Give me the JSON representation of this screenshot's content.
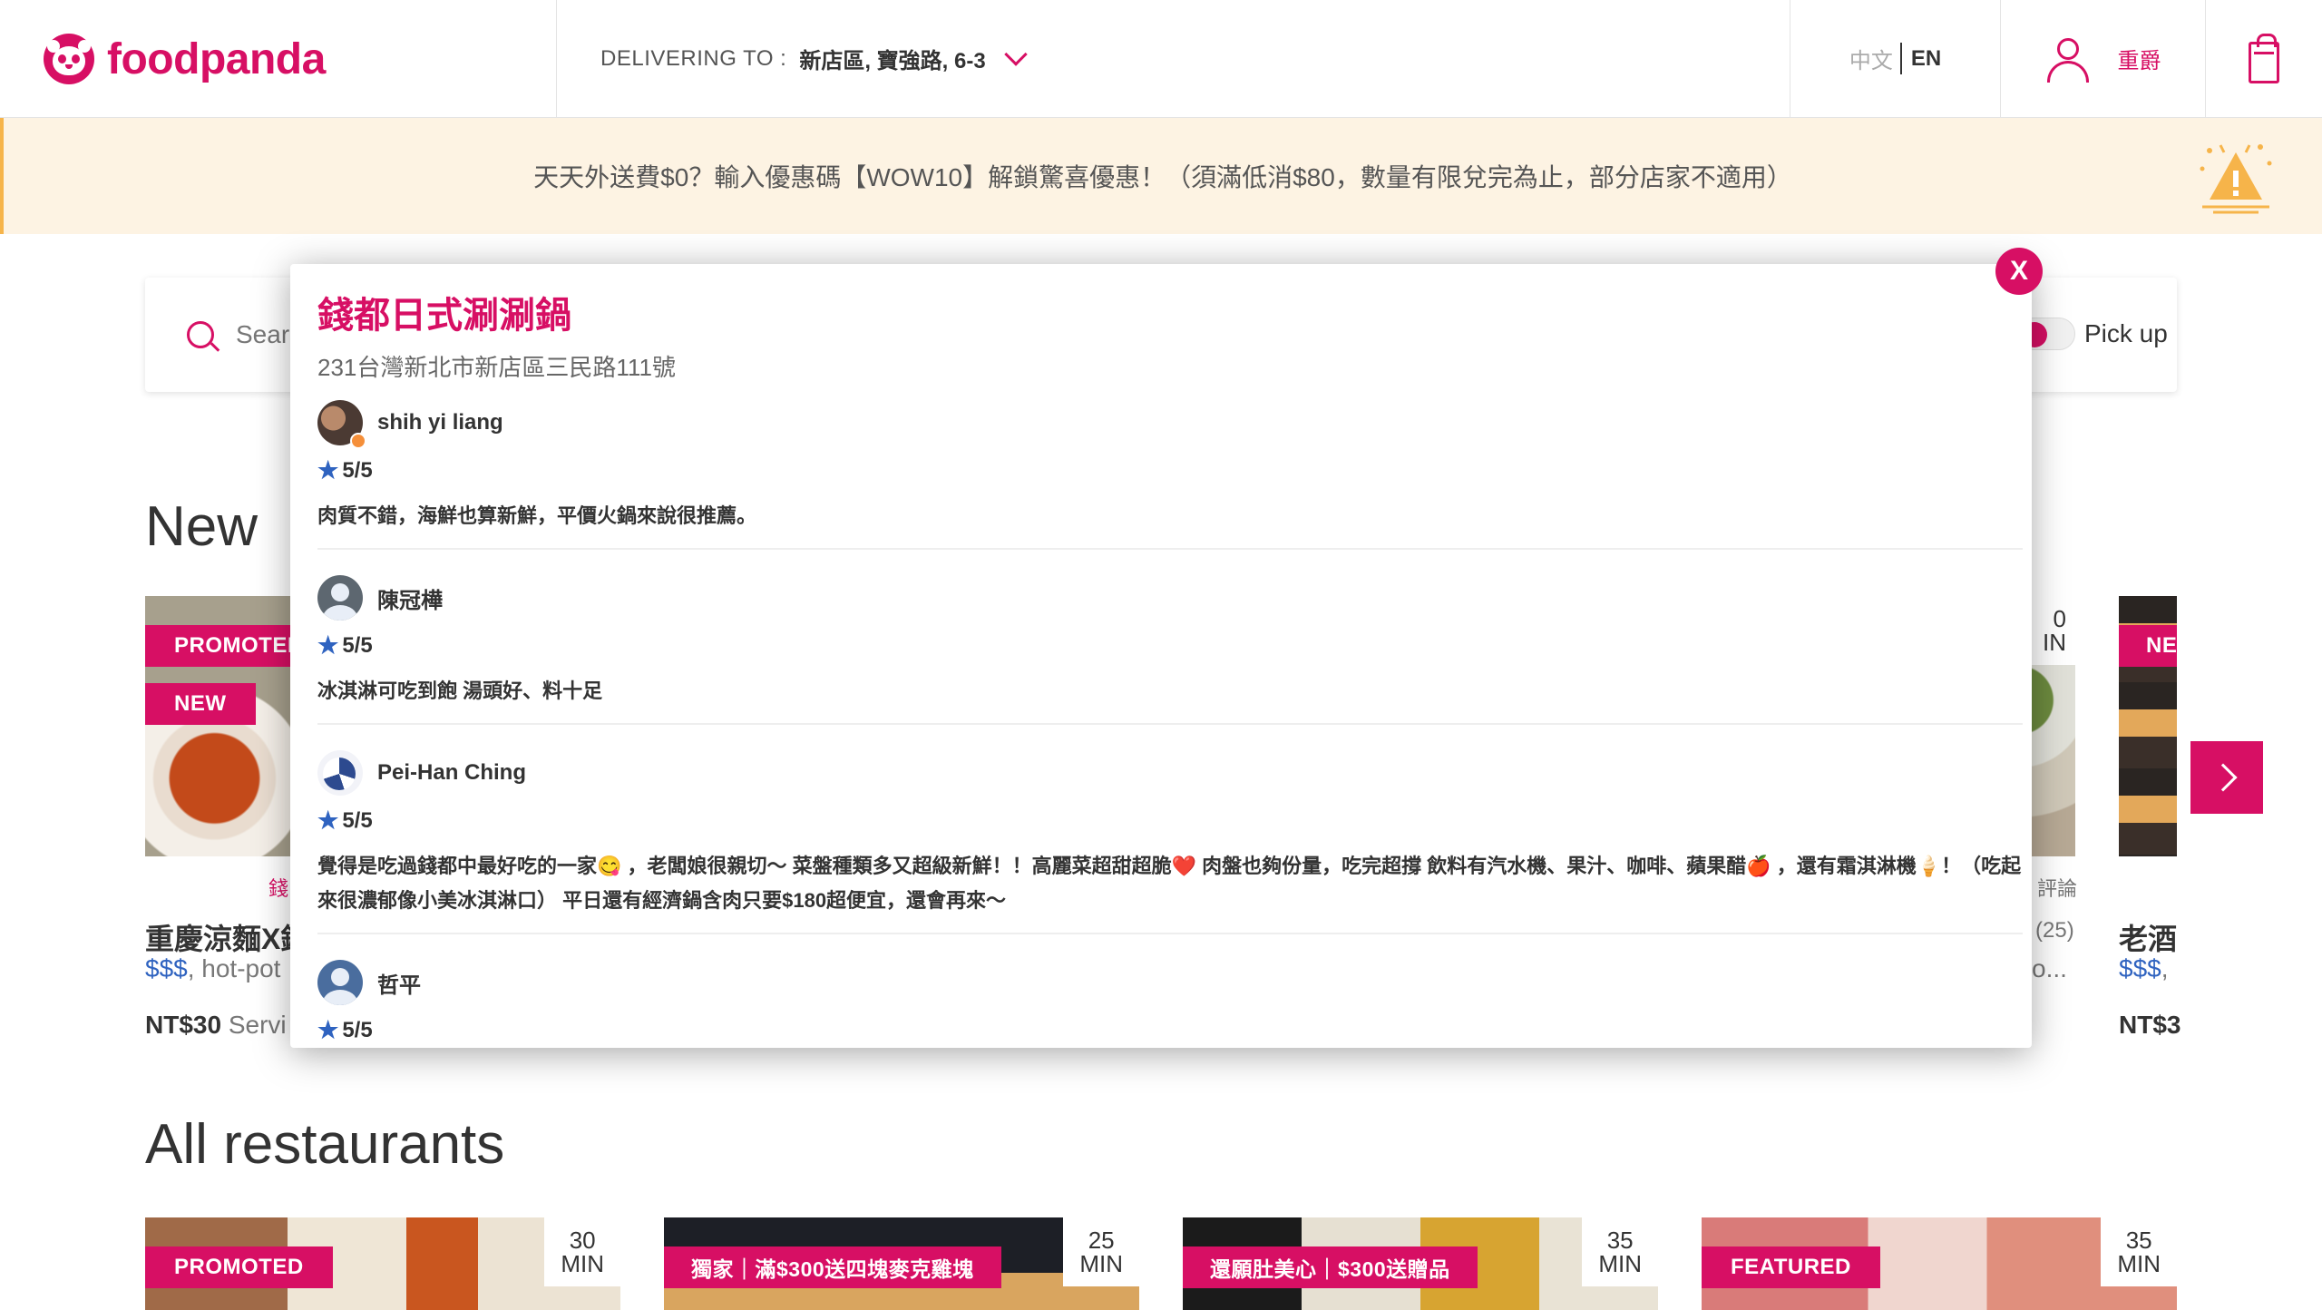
{
  "header": {
    "brand": "foodpanda",
    "delivering_label": "DELIVERING TO :",
    "address": "新店區, 寶強路, 6-3",
    "lang_zh": "中文",
    "lang_en": "EN",
    "user_name": "重爵",
    "icons": {
      "logo": "panda-logo",
      "dropdown": "chevron-down-icon",
      "user": "user-icon",
      "cart": "cart-icon"
    }
  },
  "promo": {
    "text": "天天外送費$0？輸入優惠碼【WOW10】解鎖驚喜優惠！（須滿低消$80，數量有限兌完為止，部分店家不適用）",
    "icon": "party-hat-icon"
  },
  "search": {
    "placeholder": "Sear",
    "pickup_label": "Pick up"
  },
  "sections": {
    "new_title": "New",
    "all_title": "All restaurants"
  },
  "new_cards": {
    "left": {
      "tag1": "PROMOTED",
      "tag2": "NEW",
      "sublabel": "錢",
      "title": "重慶涼麵X錢",
      "price": "$$$",
      "cuisine": ", hot-pot",
      "fee_amount": "NT$30",
      "fee_label": " Servi"
    },
    "right_partial": {
      "eta_tail_1": "0",
      "eta_tail_2": "IN",
      "review_tail": "評論",
      "rating_tail": "(25)",
      "meta_tail": "o..."
    },
    "far_right": {
      "tag": "NE",
      "title": "老酒",
      "price": "$$$",
      "cuisine": ",",
      "fee_amount": "NT$3"
    }
  },
  "all_cards": [
    {
      "tag": "PROMOTED",
      "eta_num": "30",
      "eta_unit": "MIN"
    },
    {
      "tag": "獨家｜滿$300送四塊麥克雞塊",
      "eta_num": "25",
      "eta_unit": "MIN"
    },
    {
      "tag": "還願肚美心｜$300送贈品",
      "eta_num": "35",
      "eta_unit": "MIN"
    },
    {
      "tag": "FEATURED",
      "eta_num": "35",
      "eta_unit": "MIN"
    }
  ],
  "modal": {
    "close_label": "X",
    "title": "錢都日式涮涮鍋",
    "address": "231台灣新北市新店區三民路111號",
    "reviews": [
      {
        "name": "shih yi liang",
        "rating": "5/5",
        "text": "肉質不錯，海鮮也算新鮮，平價火鍋來說很推薦。"
      },
      {
        "name": "陳冠樺",
        "rating": "5/5",
        "text": "冰淇淋可吃到飽 湯頭好、料十足"
      },
      {
        "name": "Pei-Han Ching",
        "rating": "5/5",
        "text": "覺得是吃過錢都中最好吃的一家😋 ，老闆娘很親切～ 菜盤種類多又超級新鮮！！高麗菜超甜超脆❤️ 肉盤也夠份量，吃完超撐 飲料有汽水機、果汁、咖啡、蘋果醋🍎 ，還有霜淇淋機🍦！（吃起來很濃郁像小美冰淇淋口） 平日還有經濟鍋含肉只要$180超便宜，還會再來～"
      },
      {
        "name": "哲平",
        "rating": "5/5",
        "text": ""
      }
    ]
  },
  "colors": {
    "brand": "#d70f64",
    "star": "#2f63c0",
    "promo_bg": "#fdf3e3"
  }
}
